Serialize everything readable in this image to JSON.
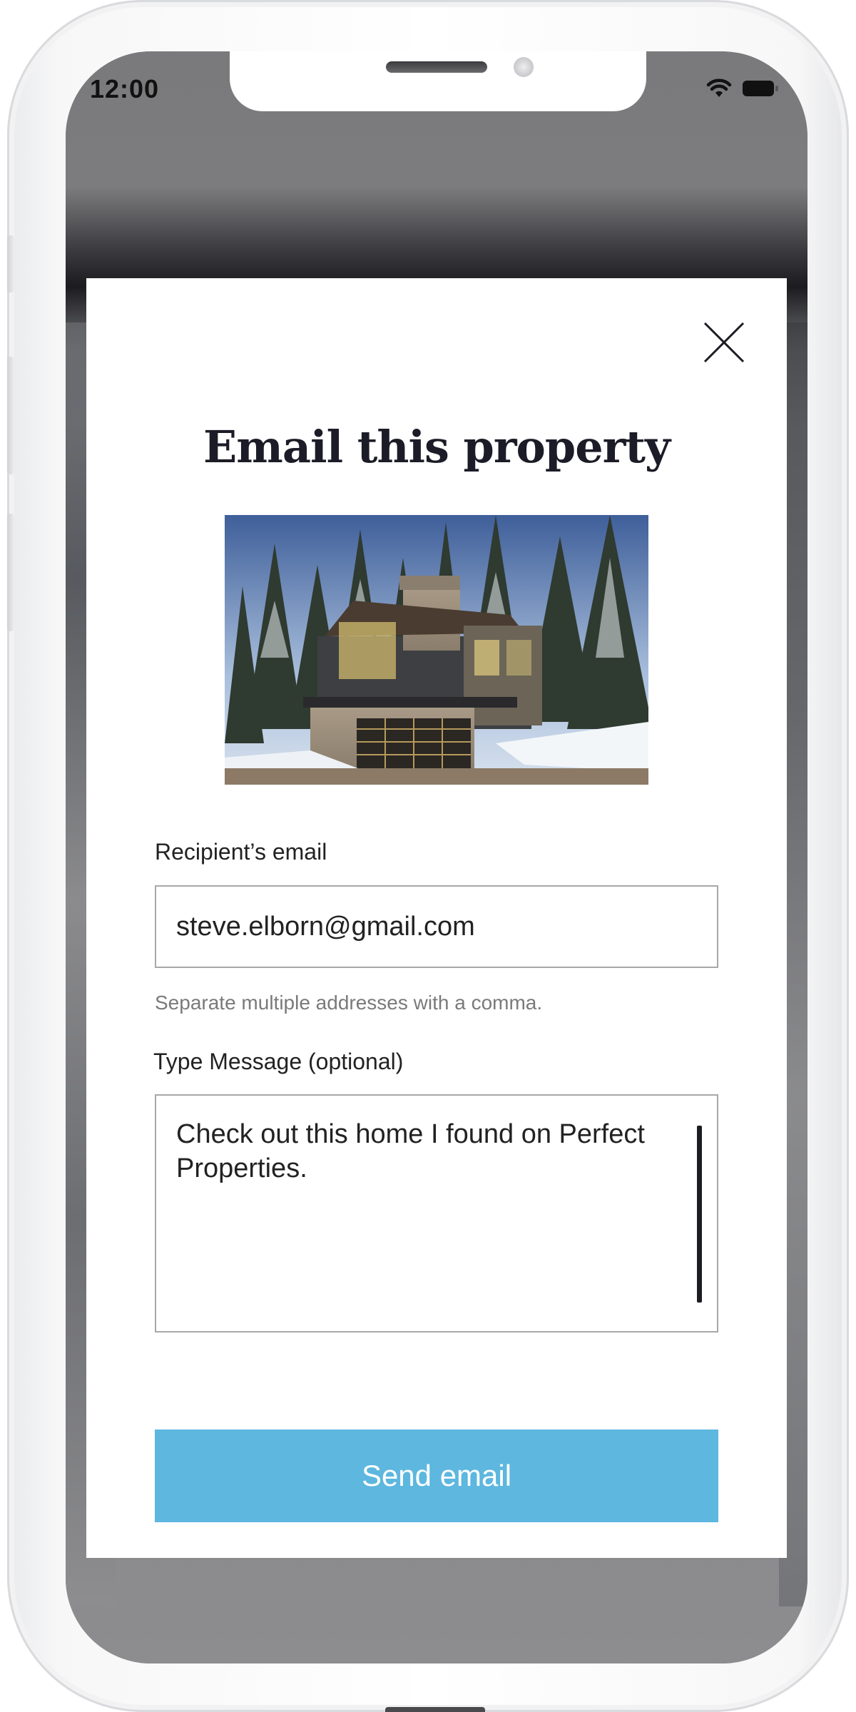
{
  "status_bar": {
    "time": "12:00",
    "wifi_icon": "wifi-icon",
    "battery_icon": "battery-icon"
  },
  "modal": {
    "close_icon": "close-icon",
    "title": "Email this property",
    "image_icon": "property-photo",
    "recipient_label": "Recipient’s email",
    "recipient_value": "steve.elborn@gmail.com",
    "helper_text": "Separate multiple addresses with a comma.",
    "message_label": "Type Message (optional)",
    "message_value": "Check out this home I found on Perfect Properties.",
    "send_label": "Send email"
  },
  "colors": {
    "accent": "#5db7df",
    "title": "#1c1c28",
    "border": "#a8a8a8"
  }
}
